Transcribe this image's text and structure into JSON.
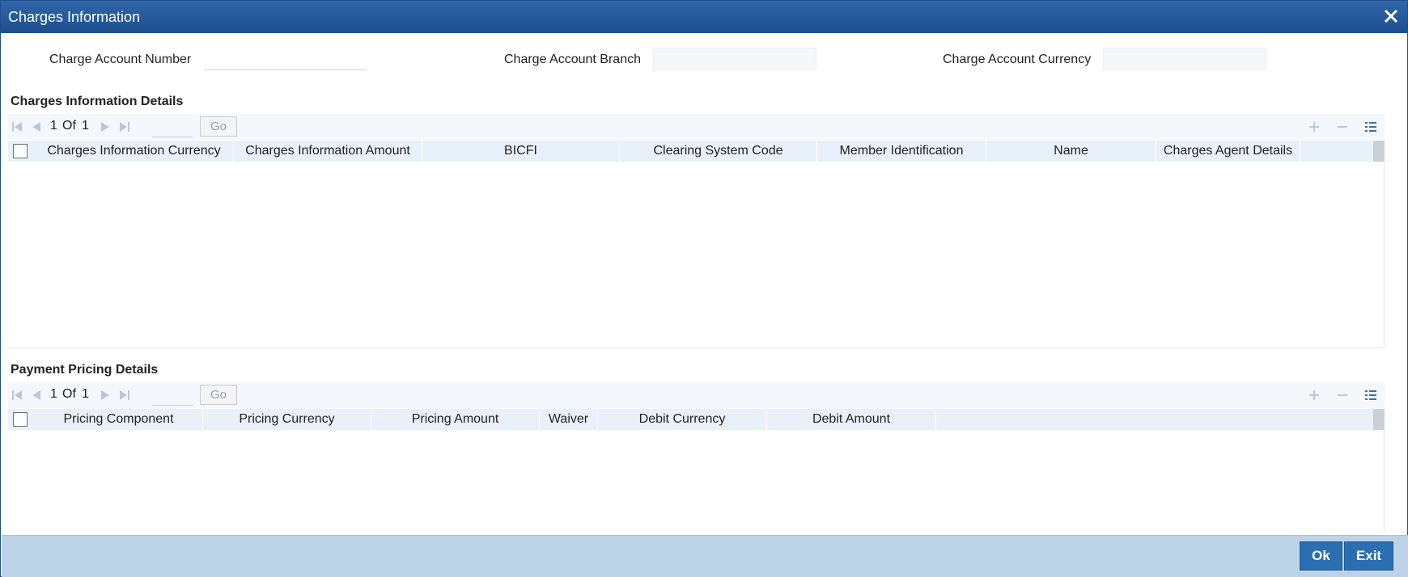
{
  "window": {
    "title": "Charges Information"
  },
  "fields": {
    "charge_account_number": {
      "label": "Charge Account Number",
      "value": ""
    },
    "charge_account_branch": {
      "label": "Charge Account Branch",
      "value": ""
    },
    "charge_account_currency": {
      "label": "Charge Account Currency",
      "value": ""
    }
  },
  "charges_section": {
    "title": "Charges Information Details",
    "pager": {
      "current": "1",
      "of_label": "Of",
      "total": "1",
      "go_label": "Go"
    },
    "columns": [
      "Charges Information Currency",
      "Charges Information Amount",
      "BICFI",
      "Clearing System Code",
      "Member Identification",
      "Name",
      "Charges Agent Details"
    ],
    "rows": []
  },
  "pricing_section": {
    "title": "Payment Pricing Details",
    "pager": {
      "current": "1",
      "of_label": "Of",
      "total": "1",
      "go_label": "Go"
    },
    "columns": [
      "Pricing Component",
      "Pricing Currency",
      "Pricing Amount",
      "Waiver",
      "Debit Currency",
      "Debit Amount"
    ],
    "rows": []
  },
  "footer": {
    "ok_label": "Ok",
    "exit_label": "Exit"
  },
  "colors": {
    "titlebar": "#1d4f8e",
    "header_row": "#e8f0f9",
    "footer": "#bcd3e8",
    "button": "#2c6fb0"
  }
}
